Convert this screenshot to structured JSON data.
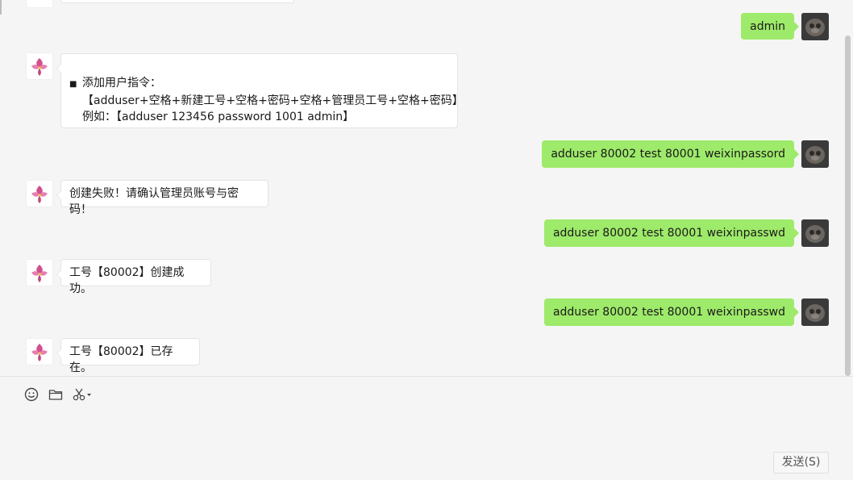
{
  "messages": [
    {
      "side": "out",
      "text": "admin"
    },
    {
      "side": "in",
      "lines": [
        "添加用户指令：",
        "【adduser+空格+新建工号+空格+密码+空格+管理员工号+空格+密码】",
        "例如：【adduser 123456 password 1001 admin】"
      ]
    },
    {
      "side": "out",
      "text": "adduser 80002 test 80001 weixinpassord"
    },
    {
      "side": "in",
      "text": "创建失败！请确认管理员账号与密码！"
    },
    {
      "side": "out",
      "text": "adduser 80002 test 80001 weixinpasswd"
    },
    {
      "side": "in",
      "text": "工号【80002】创建成功。"
    },
    {
      "side": "out",
      "text": "adduser 80002 test 80001 weixinpasswd"
    },
    {
      "side": "in",
      "text": "工号【80002】已存在。"
    }
  ],
  "bullet": "■",
  "toolbar": {
    "icons": [
      "emoji-icon",
      "folder-icon",
      "scissors-icon"
    ]
  },
  "composer": {
    "value": ""
  },
  "send_button": {
    "label": "发送(S)"
  },
  "colors": {
    "outgoing_bubble": "#9eea6a",
    "incoming_bubble": "#ffffff",
    "background": "#f5f5f5"
  }
}
